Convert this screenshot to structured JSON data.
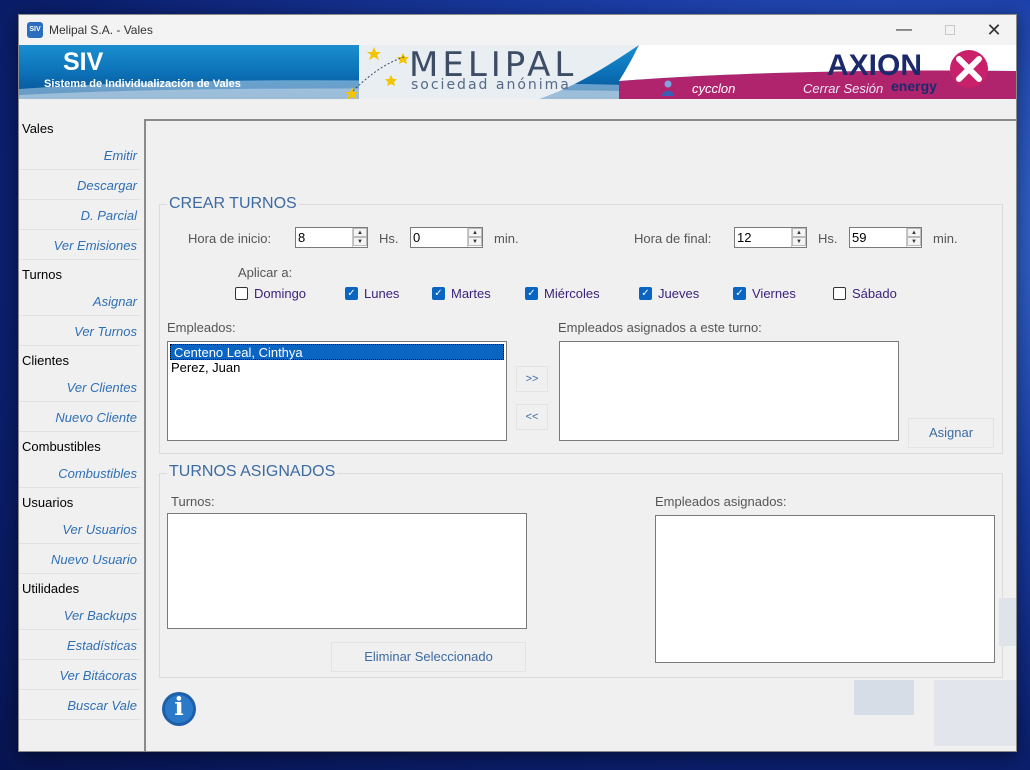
{
  "window": {
    "title": "Melipal S.A. - Vales",
    "app_icon": "SIV",
    "controls": {
      "minimize": "—",
      "close": "✕"
    }
  },
  "banner": {
    "app_name": "SIV",
    "app_subtitle": "Sistema de Individualización de Vales",
    "company_logo": "MELIPAL",
    "company_logo_sub": "sociedad anónima",
    "partner_logo": "AXION",
    "partner_logo_sub": "energy",
    "user_name": "cycclon",
    "logout_label": "Cerrar Sesión"
  },
  "sidebar": {
    "sections": [
      {
        "header": "Vales",
        "items": [
          "Emitir",
          "Descargar",
          "D. Parcial",
          "Ver Emisiones"
        ]
      },
      {
        "header": "Turnos",
        "items": [
          "Asignar",
          "Ver Turnos"
        ]
      },
      {
        "header": "Clientes",
        "items": [
          "Ver Clientes",
          "Nuevo Cliente"
        ]
      },
      {
        "header": "Combustibles",
        "items": [
          "Combustibles"
        ]
      },
      {
        "header": "Usuarios",
        "items": [
          "Ver Usuarios",
          "Nuevo Usuario"
        ]
      },
      {
        "header": "Utilidades",
        "items": [
          "Ver Backups",
          "Estadísticas",
          "Ver Bitácoras",
          "Buscar Vale"
        ]
      }
    ]
  },
  "crear_turnos": {
    "title": "CREAR TURNOS",
    "hora_inicio_label": "Hora de inicio:",
    "hora_inicio_hs": "8",
    "hs_label": "Hs.",
    "hora_inicio_min": "0",
    "min_label": "min.",
    "hora_final_label": "Hora de final:",
    "hora_final_hs": "12",
    "hora_final_min": "59",
    "aplicar_label": "Aplicar a:",
    "days": [
      {
        "label": "Domingo",
        "checked": false
      },
      {
        "label": "Lunes",
        "checked": true
      },
      {
        "label": "Martes",
        "checked": true
      },
      {
        "label": "Miércoles",
        "checked": true
      },
      {
        "label": "Jueves",
        "checked": true
      },
      {
        "label": "Viernes",
        "checked": true
      },
      {
        "label": "Sábado",
        "checked": false
      }
    ],
    "empleados_label": "Empleados:",
    "empleados": [
      "Centeno Leal, Cinthya",
      "Perez, Juan"
    ],
    "selected_empleado": "Centeno Leal, Cinthya",
    "add_button": ">>",
    "remove_button": "<<",
    "asignados_label": "Empleados asignados a este turno:",
    "asignar_button": "Asignar"
  },
  "turnos_asignados": {
    "title": "TURNOS ASIGNADOS",
    "turnos_label": "Turnos:",
    "empleados_asignados_label": "Empleados asignados:",
    "eliminar_button": "Eliminar Seleccionado"
  },
  "info_icon": "i",
  "colors": {
    "accent": "#3c6aa3",
    "link": "#2f6fb6",
    "selection": "#0a64c2",
    "banner": "#0b6fb5"
  }
}
